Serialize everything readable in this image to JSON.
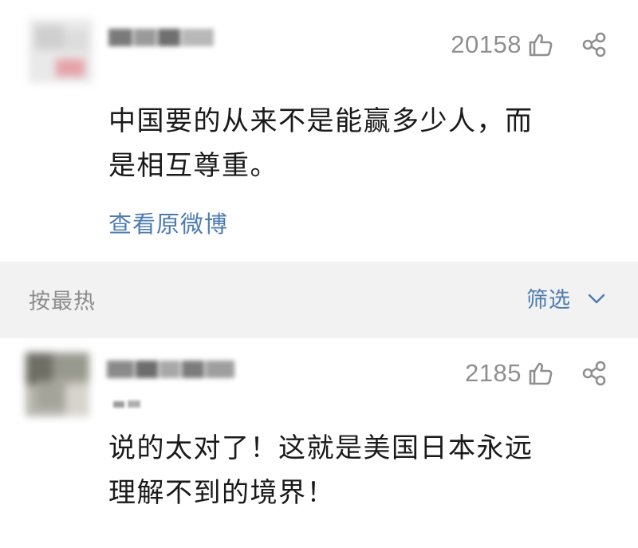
{
  "comments": [
    {
      "likes": "20158",
      "text_lines": [
        "中国要的从来不是能赢多少人，而",
        "是相互尊重。"
      ],
      "source_link": "查看原微博"
    },
    {
      "likes": "2185",
      "text_lines": [
        "说的太对了！这就是美国日本永远",
        "理解不到的境界！"
      ]
    }
  ],
  "sort_bar": {
    "sort_label": "按最热",
    "filter_label": "筛选"
  },
  "icons": {
    "like": "thumbs-up-icon",
    "share": "share-icon",
    "chevron": "chevron-down-icon"
  },
  "colors": {
    "link": "#4d7bb0",
    "meta": "#8f8f8f",
    "text": "#1a1a1a",
    "divider_bg": "#f2f2f2"
  }
}
